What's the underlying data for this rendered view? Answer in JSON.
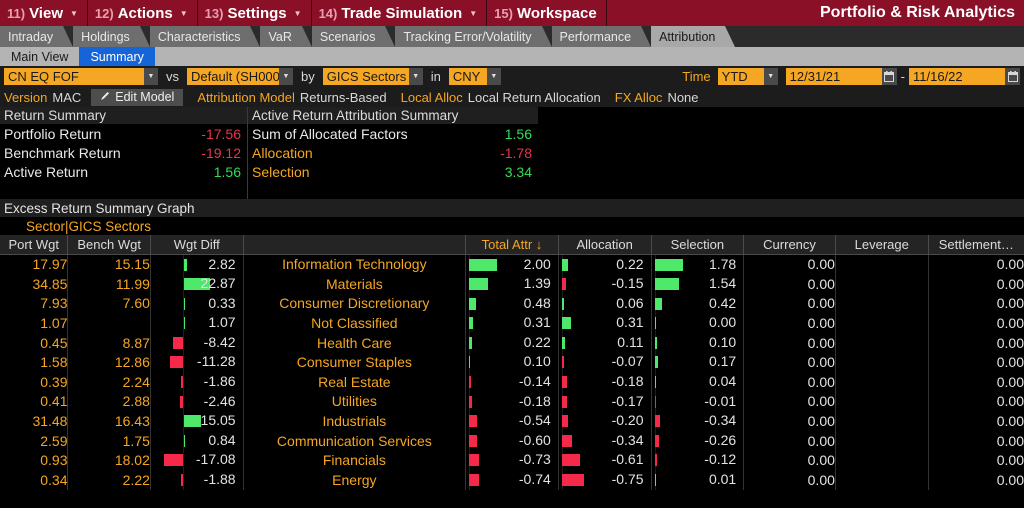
{
  "menubar": {
    "items": [
      {
        "num": "11)",
        "label": "View",
        "caret": true
      },
      {
        "num": "12)",
        "label": "Actions",
        "caret": true
      },
      {
        "num": "13)",
        "label": "Settings",
        "caret": true
      },
      {
        "num": "14)",
        "label": "Trade Simulation",
        "caret": true
      },
      {
        "num": "15)",
        "label": "Workspace",
        "caret": false
      }
    ],
    "title": "Portfolio & Risk Analytics"
  },
  "tabs": [
    {
      "label": "Intraday",
      "active": false
    },
    {
      "label": "Holdings",
      "active": false
    },
    {
      "label": "Characteristics",
      "active": false
    },
    {
      "label": "VaR",
      "active": false
    },
    {
      "label": "Scenarios",
      "active": false
    },
    {
      "label": "Tracking Error/Volatility",
      "active": false
    },
    {
      "label": "Performance",
      "active": false
    },
    {
      "label": "Attribution",
      "active": true
    }
  ],
  "subtabs": [
    {
      "label": "Main View",
      "active": false
    },
    {
      "label": "Summary",
      "active": true
    }
  ],
  "toolbar": {
    "portfolio": "CN EQ FOF",
    "vs_label": "vs",
    "benchmark": "Default (SH000",
    "by_label": "by",
    "grouping": "GICS Sectors",
    "in_label": "in",
    "currency": "CNY",
    "time_label": "Time",
    "time_period": "YTD",
    "date_start": "12/31/21",
    "date_sep": "-",
    "date_end": "11/16/22"
  },
  "modelbar": {
    "version_label": "Version",
    "version_value": "MAC",
    "edit_model": "Edit Model",
    "attribution_model_label": "Attribution Model",
    "attribution_model_value": "Returns-Based",
    "local_alloc_label": "Local Alloc",
    "local_alloc_value": "Local Return Allocation",
    "fx_alloc_label": "FX Alloc",
    "fx_alloc_value": "None"
  },
  "return_summary": {
    "title": "Return Summary",
    "rows": [
      {
        "label": "Portfolio Return",
        "value": "-17.56",
        "label_color": "white",
        "value_color": "red"
      },
      {
        "label": "Benchmark Return",
        "value": "-19.12",
        "label_color": "white",
        "value_color": "red"
      },
      {
        "label": "Active Return",
        "value": "1.56",
        "label_color": "white",
        "value_color": "green"
      }
    ]
  },
  "attribution_summary": {
    "title": "Active Return Attribution Summary",
    "rows": [
      {
        "label": "Sum of Allocated Factors",
        "value": "1.56",
        "label_color": "white",
        "value_color": "green"
      },
      {
        "label": "Allocation",
        "value": "-1.78",
        "label_color": "amber",
        "value_color": "red"
      },
      {
        "label": "Selection",
        "value": "3.34",
        "label_color": "amber",
        "value_color": "green"
      }
    ]
  },
  "graph_section": {
    "title": "Excess Return Summary Graph",
    "group_label": "Sector|GICS Sectors"
  },
  "table": {
    "headers": [
      {
        "label": "Port Wgt",
        "sorted": false
      },
      {
        "label": "Bench Wgt",
        "sorted": false
      },
      {
        "label": "Wgt Diff",
        "sorted": false
      },
      {
        "label": "",
        "sorted": false
      },
      {
        "label": "Total Attr ↓",
        "sorted": true
      },
      {
        "label": "Allocation",
        "sorted": false
      },
      {
        "label": "Selection",
        "sorted": false
      },
      {
        "label": "Currency",
        "sorted": false
      },
      {
        "label": "Leverage",
        "sorted": false
      },
      {
        "label": "Settlement…",
        "sorted": false
      }
    ],
    "rows": [
      {
        "sector": "Information Technology",
        "port_wgt": "17.97",
        "bench_wgt": "15.15",
        "wgt_diff": "2.82",
        "total_attr": "2.00",
        "allocation": "0.22",
        "selection": "1.78",
        "currency": "0.00",
        "leverage": "",
        "settlement": "0.00"
      },
      {
        "sector": "Materials",
        "port_wgt": "34.85",
        "bench_wgt": "11.99",
        "wgt_diff": "22.87",
        "total_attr": "1.39",
        "allocation": "-0.15",
        "selection": "1.54",
        "currency": "0.00",
        "leverage": "",
        "settlement": "0.00"
      },
      {
        "sector": "Consumer Discretionary",
        "port_wgt": "7.93",
        "bench_wgt": "7.60",
        "wgt_diff": "0.33",
        "total_attr": "0.48",
        "allocation": "0.06",
        "selection": "0.42",
        "currency": "0.00",
        "leverage": "",
        "settlement": "0.00"
      },
      {
        "sector": "Not Classified",
        "port_wgt": "1.07",
        "bench_wgt": "",
        "wgt_diff": "1.07",
        "total_attr": "0.31",
        "allocation": "0.31",
        "selection": "0.00",
        "currency": "0.00",
        "leverage": "",
        "settlement": "0.00"
      },
      {
        "sector": "Health Care",
        "port_wgt": "0.45",
        "bench_wgt": "8.87",
        "wgt_diff": "-8.42",
        "total_attr": "0.22",
        "allocation": "0.11",
        "selection": "0.10",
        "currency": "0.00",
        "leverage": "",
        "settlement": "0.00"
      },
      {
        "sector": "Consumer Staples",
        "port_wgt": "1.58",
        "bench_wgt": "12.86",
        "wgt_diff": "-11.28",
        "total_attr": "0.10",
        "allocation": "-0.07",
        "selection": "0.17",
        "currency": "0.00",
        "leverage": "",
        "settlement": "0.00"
      },
      {
        "sector": "Real Estate",
        "port_wgt": "0.39",
        "bench_wgt": "2.24",
        "wgt_diff": "-1.86",
        "total_attr": "-0.14",
        "allocation": "-0.18",
        "selection": "0.04",
        "currency": "0.00",
        "leverage": "",
        "settlement": "0.00"
      },
      {
        "sector": "Utilities",
        "port_wgt": "0.41",
        "bench_wgt": "2.88",
        "wgt_diff": "-2.46",
        "total_attr": "-0.18",
        "allocation": "-0.17",
        "selection": "-0.01",
        "currency": "0.00",
        "leverage": "",
        "settlement": "0.00"
      },
      {
        "sector": "Industrials",
        "port_wgt": "31.48",
        "bench_wgt": "16.43",
        "wgt_diff": "15.05",
        "total_attr": "-0.54",
        "allocation": "-0.20",
        "selection": "-0.34",
        "currency": "0.00",
        "leverage": "",
        "settlement": "0.00"
      },
      {
        "sector": "Communication Services",
        "port_wgt": "2.59",
        "bench_wgt": "1.75",
        "wgt_diff": "0.84",
        "total_attr": "-0.60",
        "allocation": "-0.34",
        "selection": "-0.26",
        "currency": "0.00",
        "leverage": "",
        "settlement": "0.00"
      },
      {
        "sector": "Financials",
        "port_wgt": "0.93",
        "bench_wgt": "18.02",
        "wgt_diff": "-17.08",
        "total_attr": "-0.73",
        "allocation": "-0.61",
        "selection": "-0.12",
        "currency": "0.00",
        "leverage": "",
        "settlement": "0.00"
      },
      {
        "sector": "Energy",
        "port_wgt": "0.34",
        "bench_wgt": "2.22",
        "wgt_diff": "-1.88",
        "total_attr": "-0.74",
        "allocation": "-0.75",
        "selection": "0.01",
        "currency": "0.00",
        "leverage": "",
        "settlement": "0.00"
      }
    ]
  },
  "chart_data": {
    "type": "bar",
    "title": "Excess Return Summary Graph",
    "categories": [
      "Information Technology",
      "Materials",
      "Consumer Discretionary",
      "Not Classified",
      "Health Care",
      "Consumer Staples",
      "Real Estate",
      "Utilities",
      "Industrials",
      "Communication Services",
      "Financials",
      "Energy"
    ],
    "series": [
      {
        "name": "Wgt Diff",
        "values": [
          2.82,
          22.87,
          0.33,
          1.07,
          -8.42,
          -11.28,
          -1.86,
          -2.46,
          15.05,
          0.84,
          -17.08,
          -1.88
        ],
        "range": [
          -22.87,
          22.87
        ]
      },
      {
        "name": "Total Attr",
        "values": [
          2.0,
          1.39,
          0.48,
          0.31,
          0.22,
          0.1,
          -0.14,
          -0.18,
          -0.54,
          -0.6,
          -0.73,
          -0.74
        ],
        "range": [
          -2.0,
          2.0
        ]
      },
      {
        "name": "Allocation",
        "values": [
          0.22,
          -0.15,
          0.06,
          0.31,
          0.11,
          -0.07,
          -0.18,
          -0.17,
          -0.2,
          -0.34,
          -0.61,
          -0.75
        ],
        "range": [
          -0.75,
          0.75
        ]
      },
      {
        "name": "Selection",
        "values": [
          1.78,
          1.54,
          0.42,
          0.0,
          0.1,
          0.17,
          0.04,
          -0.01,
          -0.34,
          -0.26,
          -0.12,
          0.01
        ],
        "range": [
          -1.78,
          1.78
        ]
      }
    ],
    "positive_color": "#4ee86b",
    "negative_color": "#f5294a",
    "grid": false,
    "legend": "none"
  },
  "colors": {
    "brand_red": "#8a1028",
    "amber": "#f5a623",
    "green": "#33dd55",
    "red": "#e8344e",
    "bar_green": "#4ee86b",
    "bar_red": "#f5294a"
  }
}
